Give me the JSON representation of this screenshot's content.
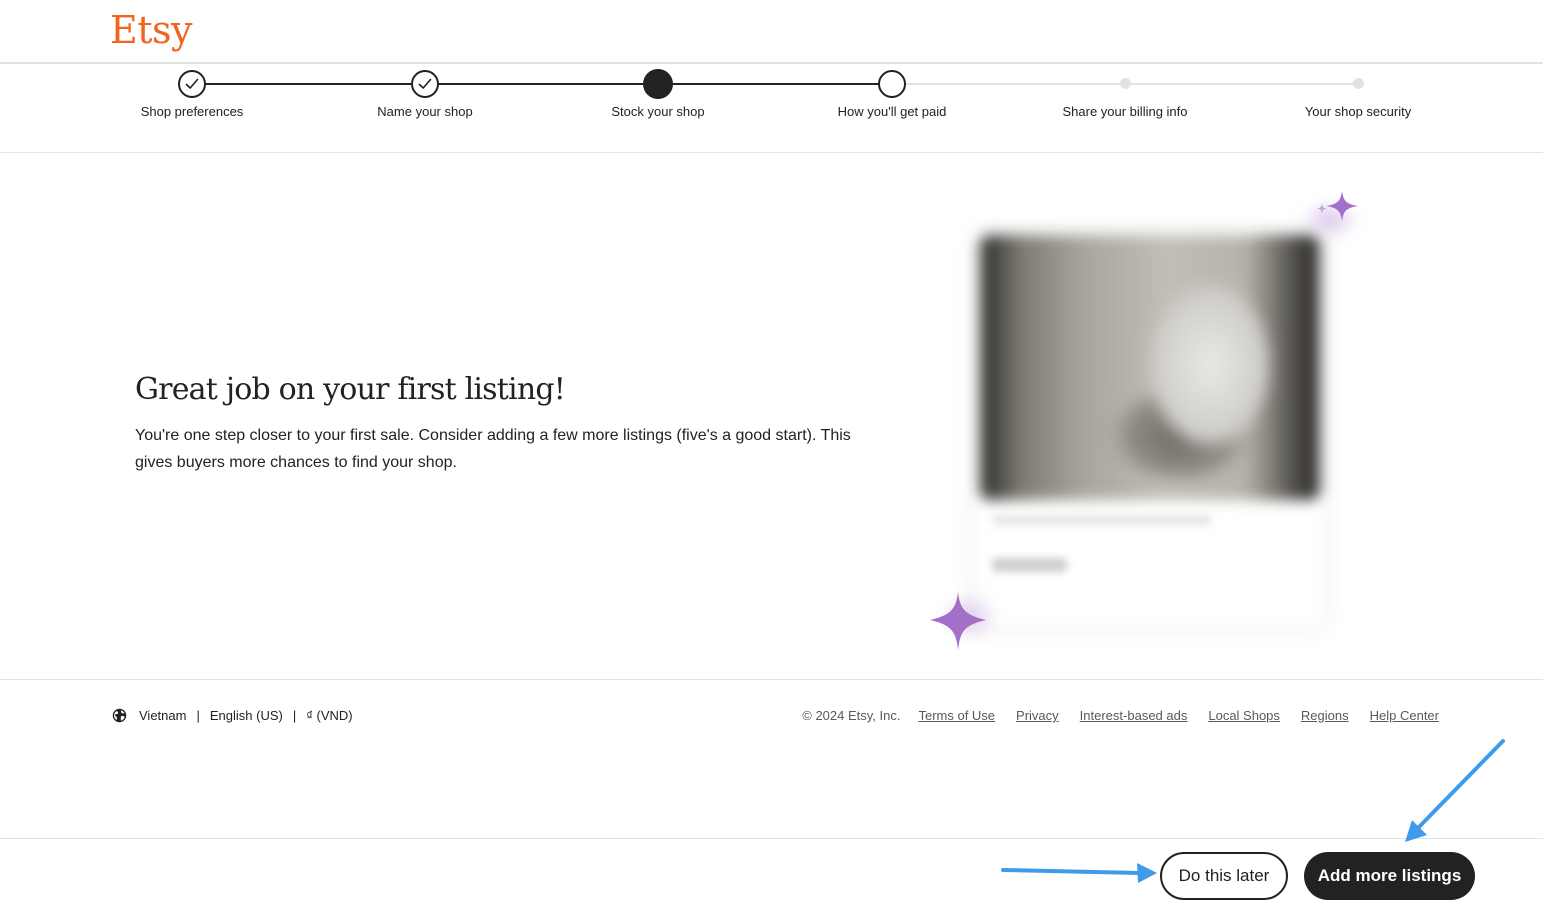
{
  "header": {
    "logo_text": "Etsy"
  },
  "stepper": {
    "steps": [
      {
        "label": "Shop preferences",
        "status": "complete"
      },
      {
        "label": "Name your shop",
        "status": "complete"
      },
      {
        "label": "Stock your shop",
        "status": "current"
      },
      {
        "label": "How you'll get paid",
        "status": "next"
      },
      {
        "label": "Share your billing info",
        "status": "upcoming"
      },
      {
        "label": "Your shop security",
        "status": "upcoming"
      }
    ]
  },
  "main": {
    "headline": "Great job on your first listing!",
    "body": "You're one step closer to your first sale. Consider adding a few more listings (five's a good start). This gives buyers more chances to find your shop."
  },
  "footer": {
    "country": "Vietnam",
    "language": "English (US)",
    "currency": "₫ (VND)",
    "separator": "|",
    "copyright": "© 2024 Etsy, Inc.",
    "links": [
      "Terms of Use",
      "Privacy",
      "Interest-based ads",
      "Local Shops",
      "Regions",
      "Help Center"
    ]
  },
  "actions": {
    "secondary_label": "Do this later",
    "primary_label": "Add more listings"
  },
  "colors": {
    "brand": "#f1641e",
    "primary_button": "#222222",
    "annotation_arrow": "#3d9be9",
    "sparkle": "#a46fc9"
  },
  "icons": {
    "check": "check-icon",
    "globe": "globe-icon",
    "sparkle": "sparkle-icon",
    "arrow": "arrow-annotation"
  }
}
